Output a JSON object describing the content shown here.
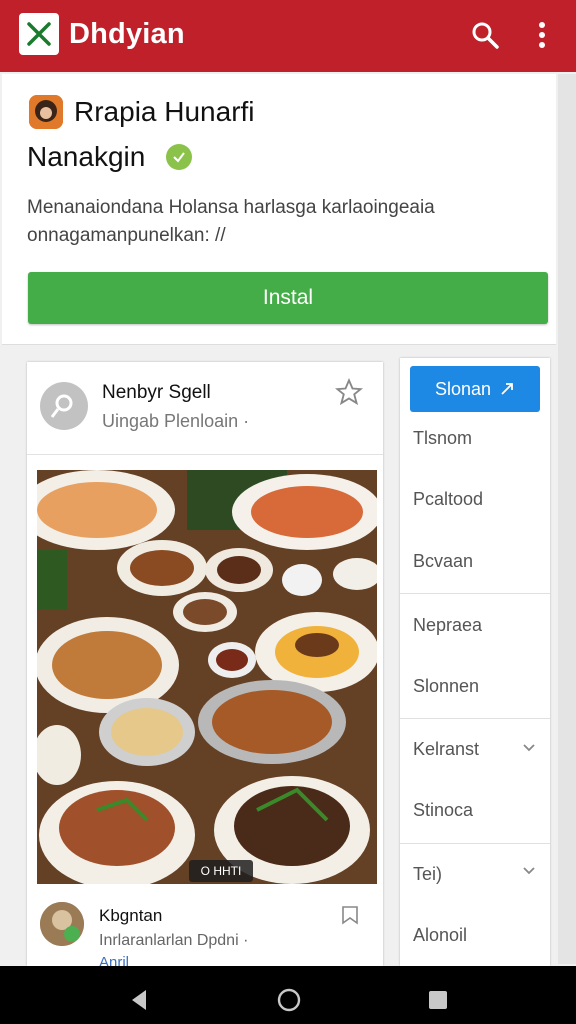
{
  "appbar": {
    "title": "Dhdyian",
    "search_icon": "search-icon",
    "more_icon": "more-vert-icon",
    "color": "#c0202a"
  },
  "app_card": {
    "name_line1": "Rrapia Hunarfi",
    "name_line2": "Nanakgin",
    "description": "Menanaiondana Holansa harlasga karlaoingeaia onnagamanpunelkan: //",
    "install_label": "Instal",
    "install_color": "#45ad48"
  },
  "post": {
    "author": "Nenbyr Sgell",
    "subtitle": "Uingab Plenloain ·",
    "photo_badge": "O HHTI",
    "footer_name": "Kbgntan",
    "footer_sub": "Inrlaranlarlan Dpdni ·",
    "footer_link": "Anril"
  },
  "side_menu": {
    "primary_label": "Slonan",
    "items": [
      "Tlsnom",
      "Pcaltood",
      "Bcvaan",
      "Nepraea",
      "Slonnen",
      "Kelranst",
      "Stinoca",
      "Tei)",
      "Alonoil"
    ],
    "primary_color": "#1e88e5"
  }
}
